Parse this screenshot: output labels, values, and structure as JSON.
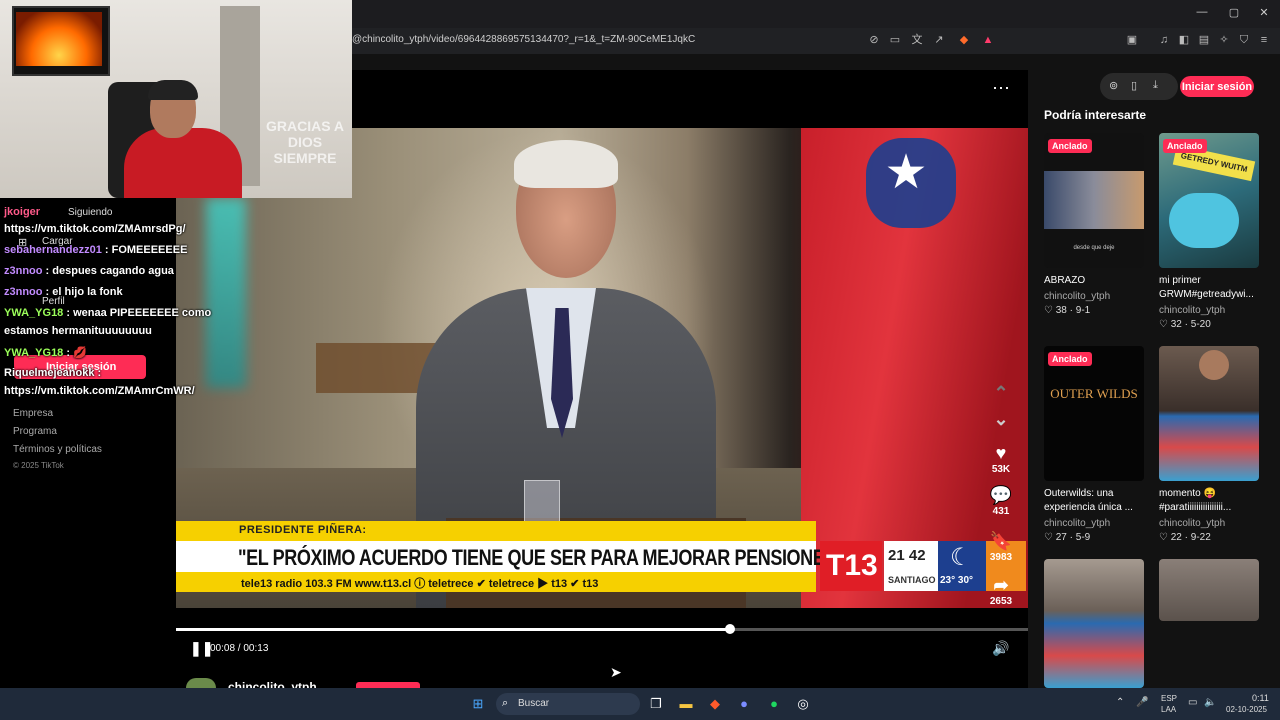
{
  "browser": {
    "url": "@chincolito_ytph/video/6964428869575134470?_r=1&_t=ZM-90CeME1JqkC"
  },
  "video": {
    "lower_third": {
      "kicker": "PRESIDENTE PIÑERA:",
      "headline": "\"EL PRÓXIMO ACUERDO TIENE QUE SER PARA MEJORAR PENSIONES\"",
      "ticker": "tele13 radio 103.3 FM    www.t13.cl    ⓘ teletrece    ✔ teletrece    ▶ t13    ✔ t13",
      "channel": "T13",
      "time": "21 42",
      "city": "SANTIAGO",
      "temp": "23° 30°"
    },
    "likes": "53K",
    "comments": "431",
    "saves": "3983",
    "shares": "2653",
    "progress": 0.65,
    "time_display": "00:08 / 00:13"
  },
  "header": {
    "login_label": "Iniciar sesión",
    "more_label": "⋯"
  },
  "author": {
    "name": "chincolito_ytph"
  },
  "sidebar": {
    "title": "Podría interesarte",
    "cards": [
      {
        "pinned": "Anclado",
        "title": "ABRAZO",
        "author": "chincolito_ytph",
        "stats": "♡ 38 · 9-1",
        "caption": "desde que deje"
      },
      {
        "pinned": "Anclado",
        "title": "mi primer GRWM#getreadywi...",
        "author": "chincolito_ytph",
        "stats": "♡ 32 · 5-20",
        "caption": "GETREDY WUITM"
      },
      {
        "pinned": "Anclado",
        "title": "Outerwilds: una experiencia única ...",
        "author": "chincolito_ytph",
        "stats": "♡ 27 · 5-9",
        "caption": "OUTER WILDS"
      },
      {
        "pinned": "",
        "title": "momento 😝 #paratiiiiiiiiiiiiiiii...",
        "author": "chincolito_ytph",
        "stats": "♡ 22 · 9-22",
        "caption": ""
      }
    ]
  },
  "left_nav": {
    "items": [
      "Siguiendo",
      "Cargar",
      "Perfil"
    ],
    "login_label": "Iniciar sesión",
    "footer": [
      "Empresa",
      "Programa",
      "Términos y políticas",
      "© 2025 TikTok"
    ]
  },
  "chat": [
    {
      "user": "jkoiger",
      "text": "",
      "color": "#ff5a8a"
    },
    {
      "user": "",
      "text": "https://vm.tiktok.com/ZMAmrsdPg/",
      "color": "#ffffff"
    },
    {
      "user": "sebahernandezz01",
      "text": " : FOMEEEEEEE",
      "color": "#c28bff"
    },
    {
      "user": "z3nnoo",
      "text": " : despues cagando agua",
      "color": "#c28bff"
    },
    {
      "user": "z3nnoo",
      "text": " : el hijo la fonk",
      "color": "#c28bff"
    },
    {
      "user": "YWA_YG18",
      "text": " : wenaa PIPEEEEEEE como",
      "color": "#9cff5a"
    },
    {
      "user": "",
      "text": "estamos hermanituuuuuuuu",
      "color": "#ffffff"
    },
    {
      "user": "YWA_YG18",
      "text": " : 💋",
      "color": "#9cff5a"
    },
    {
      "user": "",
      "text": "Riquelmejeanokk :",
      "color": "#ffffff"
    },
    {
      "user": "",
      "text": "https://vm.tiktok.com/ZMAmrCmWR/",
      "color": "#ffffff"
    }
  ],
  "webcam": {
    "wall_text": "GRACIAS A DIOS SIEMPRE"
  },
  "taskbar": {
    "search_label": "Buscar",
    "lang": "ESP",
    "lang2": "LAA",
    "clock_time": "0:11",
    "clock_date": "02-10-2025"
  }
}
